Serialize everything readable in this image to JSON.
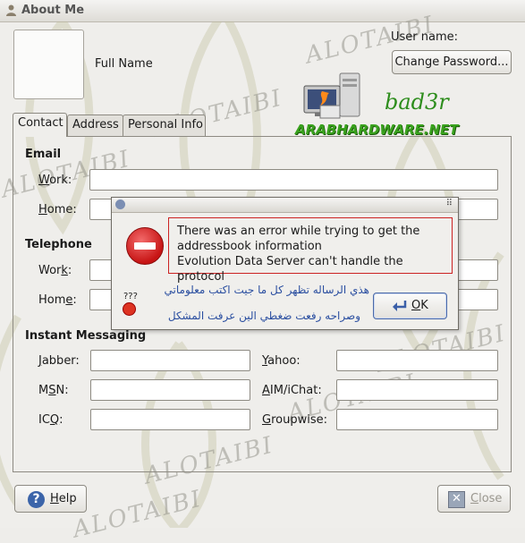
{
  "window": {
    "title": "About Me"
  },
  "header": {
    "full_name": "Full Name",
    "user_name_label": "User name:",
    "change_password": "Change Password..."
  },
  "logo": {
    "brand": "ARABHARDWARE.NET",
    "tag": "bad3r"
  },
  "watermark": "ALOTAIBI",
  "tabs": [
    {
      "label": "Contact",
      "active": true
    },
    {
      "label": "Address",
      "active": false
    },
    {
      "label": "Personal Info",
      "active": false
    }
  ],
  "sections": {
    "email": {
      "title": "Email",
      "work": {
        "pre": "",
        "key": "W",
        "post": "ork:"
      },
      "home": {
        "pre": "",
        "key": "H",
        "post": "ome:"
      }
    },
    "telephone": {
      "title": "Telephone",
      "work": {
        "pre": "Wor",
        "key": "k",
        "post": ":"
      },
      "home": {
        "pre": "Hom",
        "key": "e",
        "post": ":"
      }
    },
    "im": {
      "title": "Instant Messaging",
      "jabber": {
        "pre": "",
        "key": "J",
        "post": "abber:"
      },
      "msn": {
        "pre": "M",
        "key": "S",
        "post": "N:"
      },
      "icq": {
        "pre": "IC",
        "key": "Q",
        "post": ":"
      },
      "yahoo": {
        "pre": "",
        "key": "Y",
        "post": "ahoo:"
      },
      "aim": {
        "pre": "",
        "key": "A",
        "post": "IM/iChat:"
      },
      "groupwise": {
        "pre": "",
        "key": "G",
        "post": "roupwise:"
      }
    }
  },
  "buttons": {
    "help": {
      "key": "H",
      "post": "elp"
    },
    "close": {
      "key": "C",
      "post": "lose"
    }
  },
  "dialog": {
    "line1": "There was an error while trying to get the",
    "line2": "addressbook information",
    "line3": "Evolution Data Server can't handle the protocol",
    "arabic1": "هذي الرساله تظهر كل ما جيت اكتب معلوماتي",
    "arabic2": "وصراحه رفعت ضغطي الين عرفت المشكل",
    "qmarks": "???",
    "ok": {
      "key": "O",
      "post": "K"
    }
  },
  "colors": {
    "error_red": "#c71414",
    "brand_green": "#3aa21e",
    "arabic_blue": "#2a4ea0"
  }
}
